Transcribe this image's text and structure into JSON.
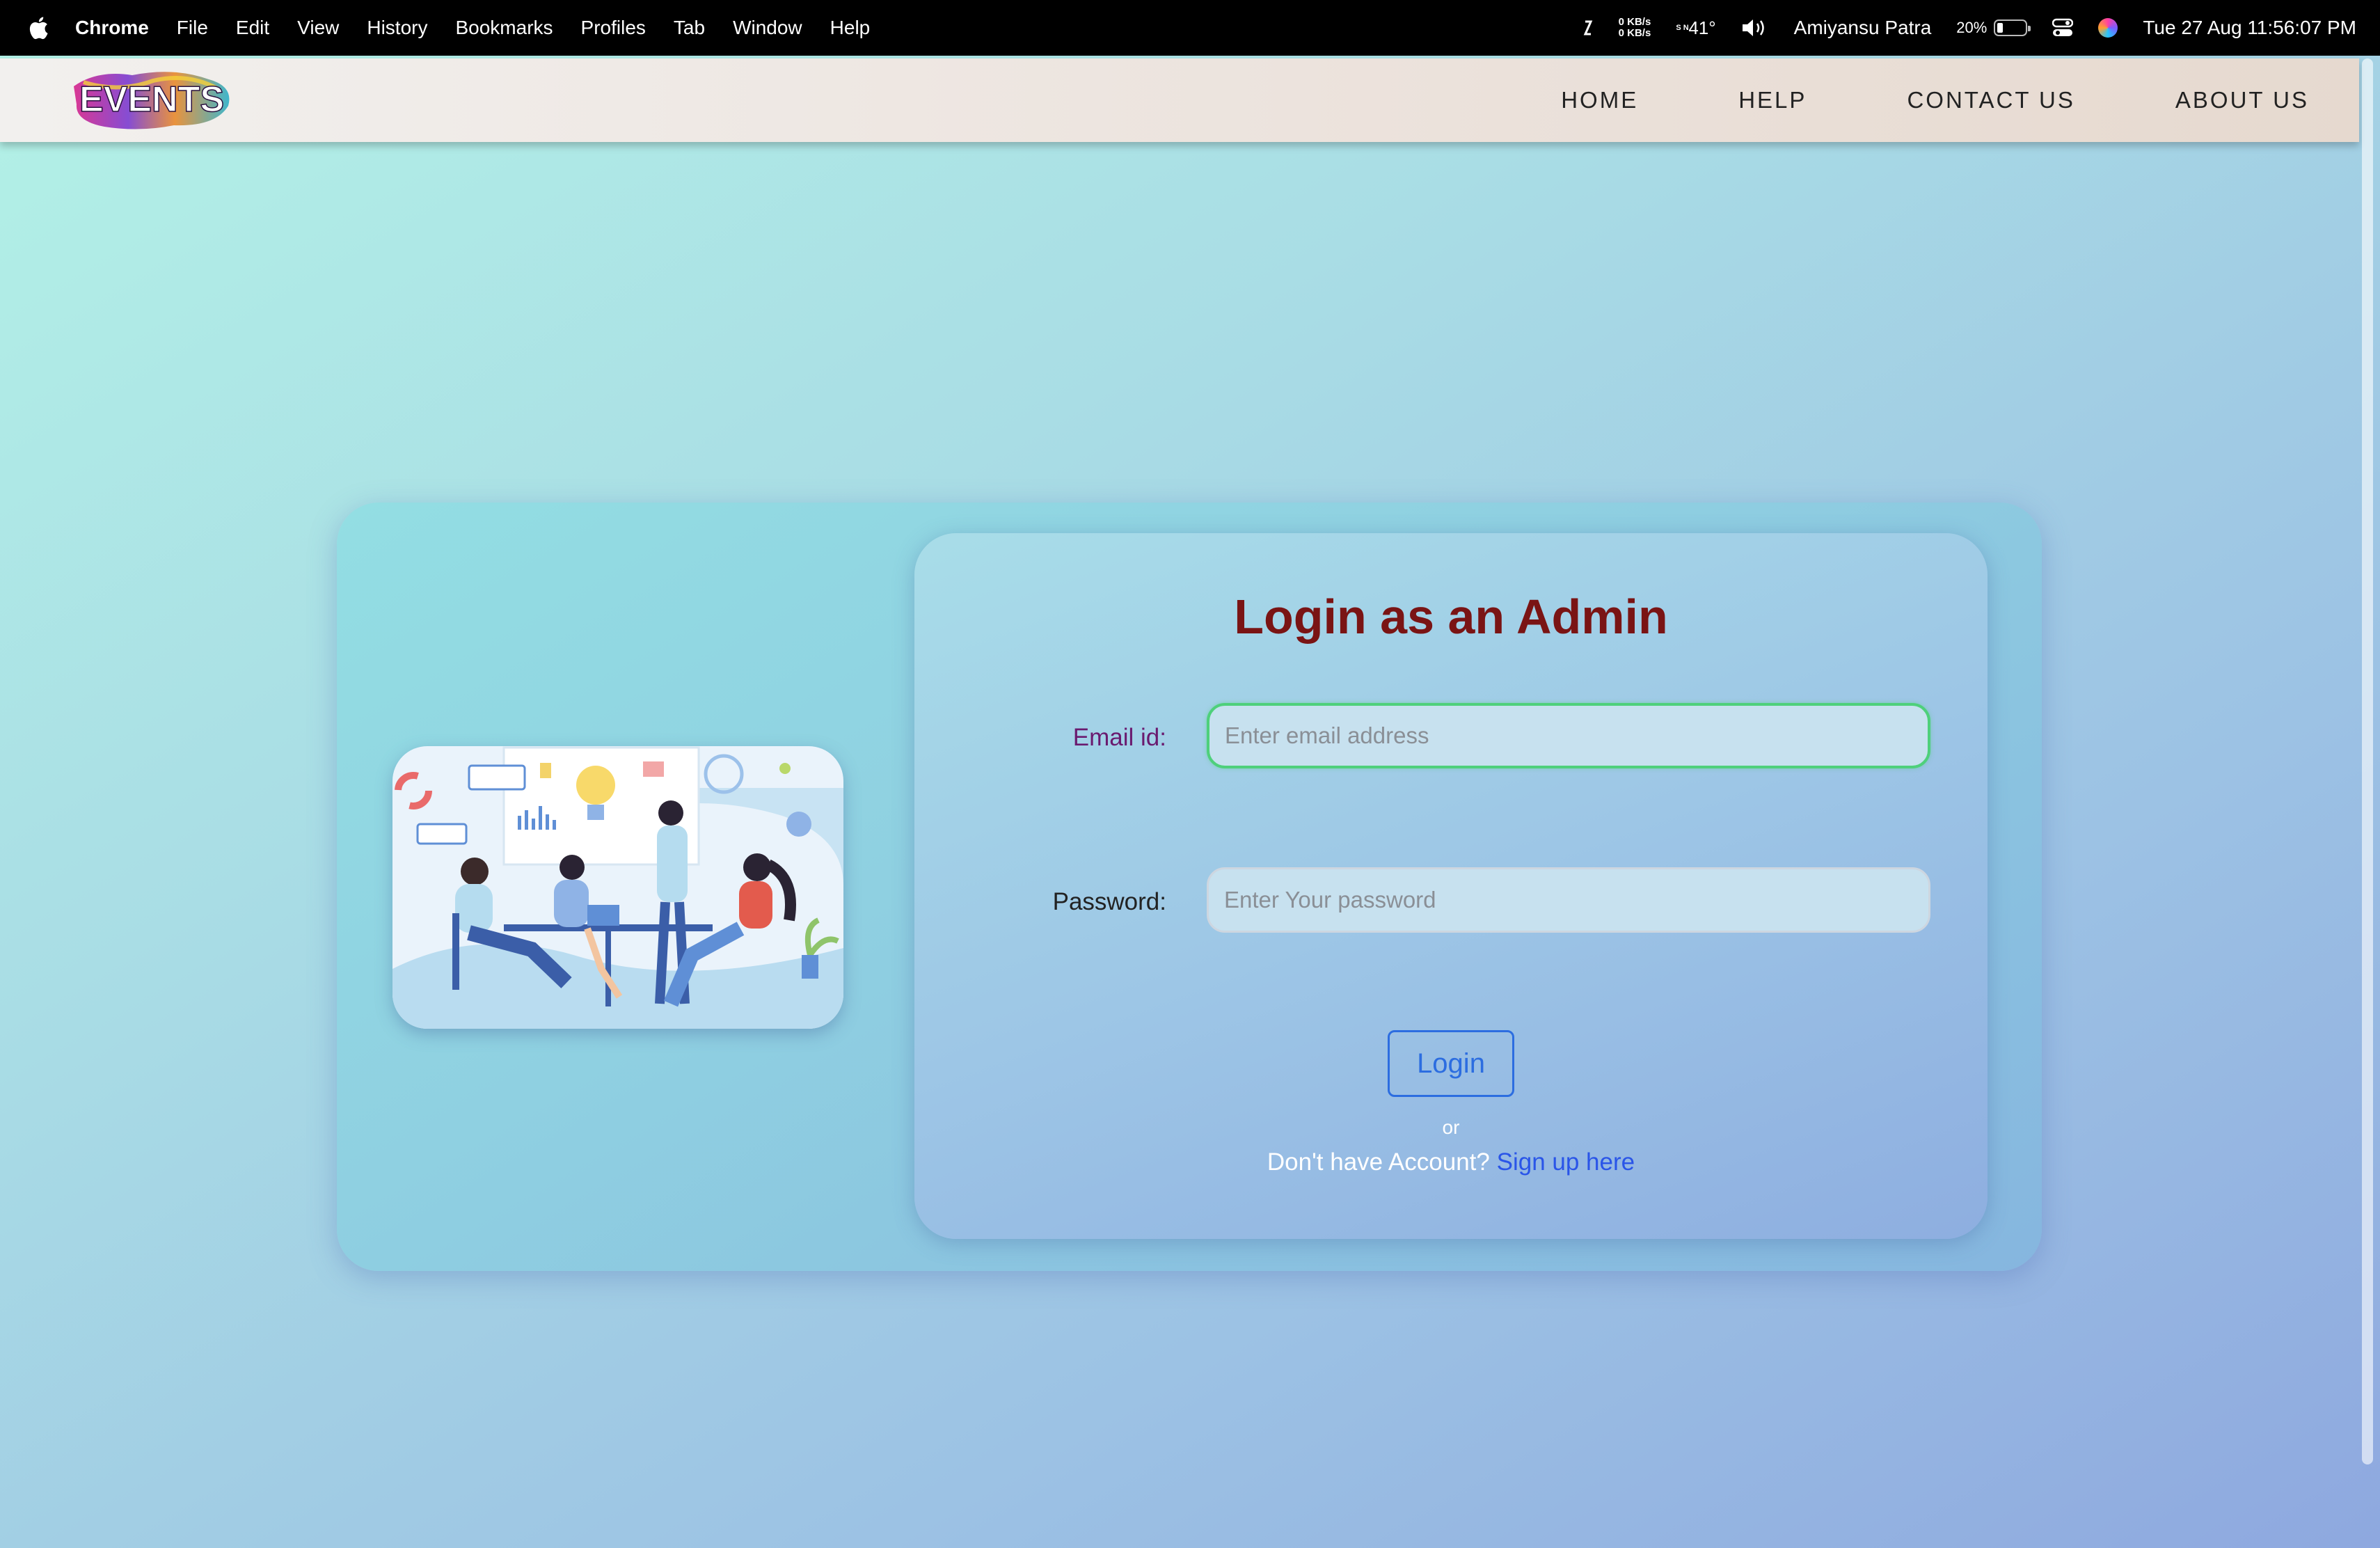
{
  "menubar": {
    "app_name": "Chrome",
    "items": [
      "File",
      "Edit",
      "View",
      "History",
      "Bookmarks",
      "Profiles",
      "Tab",
      "Window",
      "Help"
    ],
    "net_up": "0 KB/s",
    "net_down": "0 KB/s",
    "temp_letters": "S N",
    "temperature": "41°",
    "user": "Amiyansu Patra",
    "battery_percent": "20%",
    "battery_level": 0.2,
    "datetime": "Tue 27 Aug  11:56:07 PM"
  },
  "header": {
    "logo_text": "EVENTS",
    "nav": [
      "HOME",
      "HELP",
      "CONTACT US",
      "ABOUT US"
    ]
  },
  "login": {
    "title": "Login as an Admin",
    "email_label": "Email id:",
    "email_placeholder": "Enter email address",
    "password_label": "Password:",
    "password_placeholder": "Enter Your password",
    "button_label": "Login",
    "or_text": "or",
    "signup_prompt": "Don't have Account?",
    "signup_link": "Sign up here"
  },
  "colors": {
    "title": "#7a1414",
    "email_label": "#6a1a6f",
    "link": "#2a55e8",
    "button": "#2c6de0",
    "focus_border": "#4ed07b"
  }
}
